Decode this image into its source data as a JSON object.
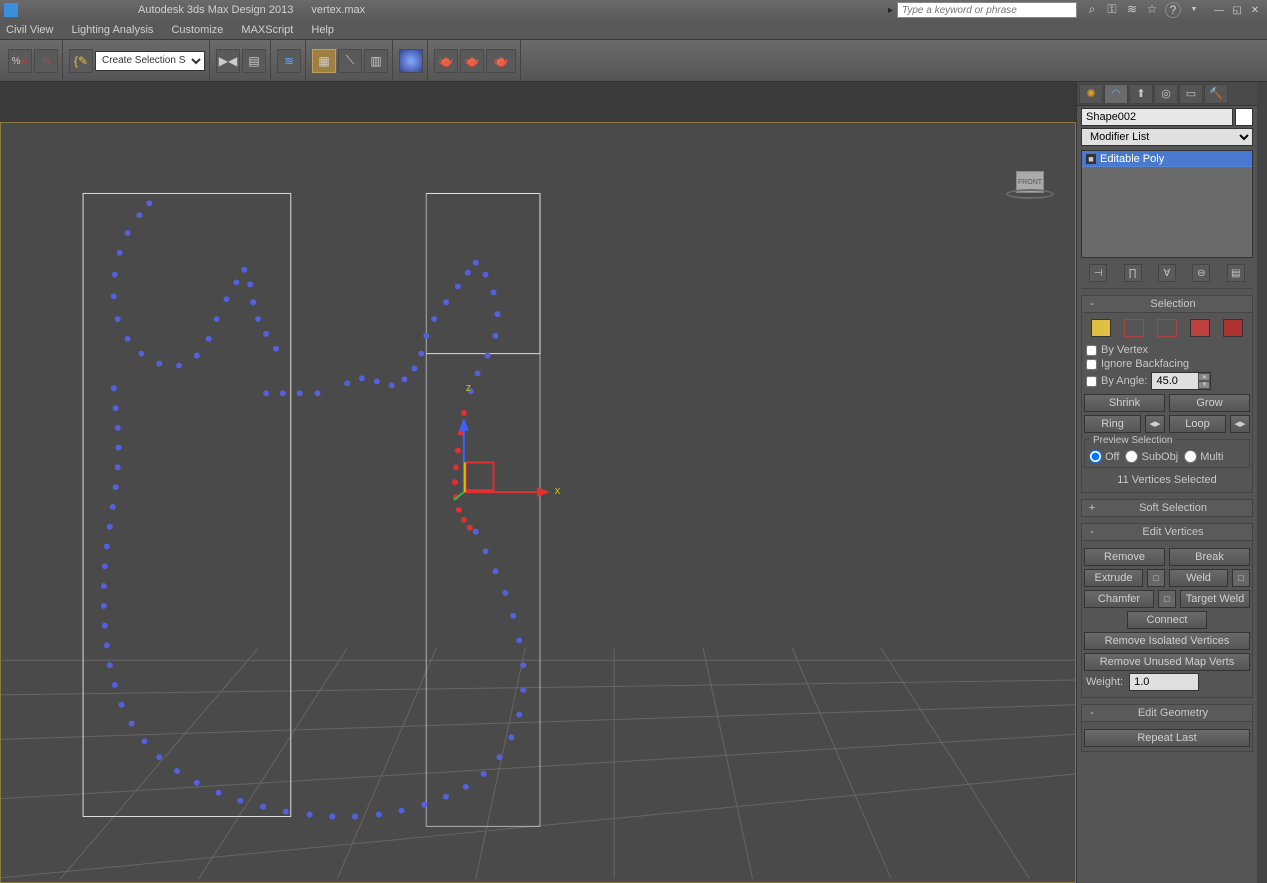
{
  "title": {
    "app": "Autodesk 3ds Max Design 2013",
    "file": "vertex.max"
  },
  "search": {
    "placeholder": "Type a keyword or phrase"
  },
  "menubar": [
    "Civil View",
    "Lighting Analysis",
    "Customize",
    "MAXScript",
    "Help"
  ],
  "toolbar": {
    "select_set": "Create Selection Se"
  },
  "viewport": {
    "cube_face": "FRONT"
  },
  "panel": {
    "object_name": "Shape002",
    "modifier_list": "Modifier List",
    "stack_item": "Editable Poly",
    "rollouts": {
      "selection": {
        "title": "Selection",
        "by_vertex": "By Vertex",
        "ignore_backfacing": "Ignore Backfacing",
        "by_angle": "By Angle:",
        "angle_value": "45.0",
        "shrink": "Shrink",
        "grow": "Grow",
        "ring": "Ring",
        "loop": "Loop",
        "preview_label": "Preview Selection",
        "off": "Off",
        "subobj": "SubObj",
        "multi": "Multi",
        "status": "11 Vertices Selected"
      },
      "soft": {
        "title": "Soft Selection"
      },
      "edit_vertices": {
        "title": "Edit Vertices",
        "remove": "Remove",
        "break": "Break",
        "extrude": "Extrude",
        "weld": "Weld",
        "chamfer": "Chamfer",
        "target_weld": "Target Weld",
        "connect": "Connect",
        "rem_iso": "Remove Isolated Vertices",
        "rem_unused": "Remove Unused Map Verts",
        "weight_lbl": "Weight:",
        "weight_val": "1.0"
      },
      "edit_geom": {
        "title": "Edit Geometry",
        "repeat": "Repeat Last"
      }
    }
  }
}
